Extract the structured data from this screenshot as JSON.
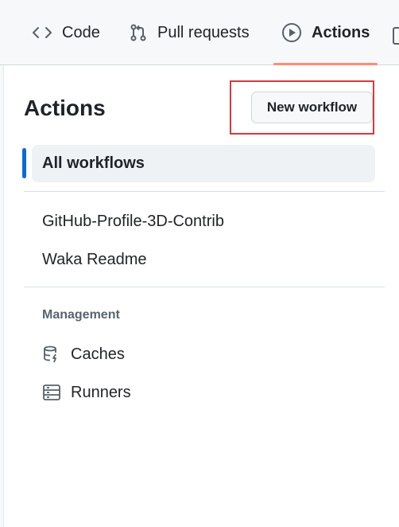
{
  "nav": {
    "tabs": [
      {
        "label": "Code",
        "icon": "code-icon"
      },
      {
        "label": "Pull requests",
        "icon": "git-pull-request-icon"
      },
      {
        "label": "Actions",
        "icon": "play-icon",
        "selected": true
      }
    ]
  },
  "sidebar": {
    "title": "Actions",
    "new_workflow_label": "New workflow",
    "all_workflows_label": "All workflows",
    "workflows": [
      "GitHub-Profile-3D-Contrib",
      "Waka Readme"
    ],
    "management_heading": "Management",
    "management_items": [
      {
        "label": "Caches",
        "icon": "database-icon"
      },
      {
        "label": "Runners",
        "icon": "server-icon"
      }
    ]
  },
  "colors": {
    "accent_blue": "#0969da",
    "tab_underline": "#fd8c73",
    "highlight_red": "#d9393f"
  }
}
